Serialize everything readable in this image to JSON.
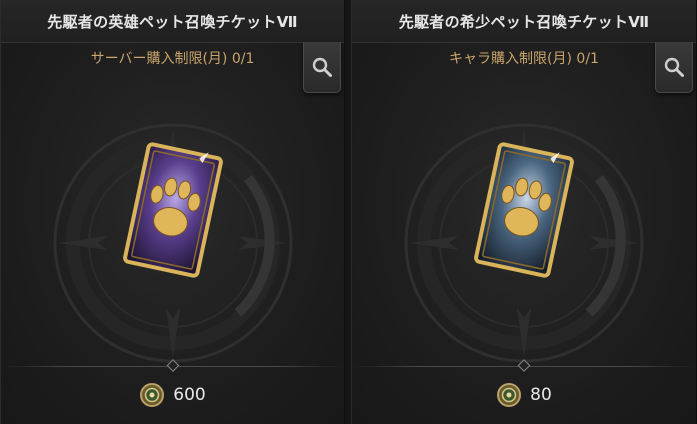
{
  "shop": {
    "items": [
      {
        "title": "先駆者の英雄ペット召喚チケットⅦ",
        "limit": "サーバー購入制限(月) 0/1",
        "ticket_gem_color": "#5a3f8e",
        "price": "600",
        "currency_icon": "medal-coin-icon",
        "inspect_icon": "magnifier-icon"
      },
      {
        "title": "先駆者の希少ペット召喚チケットⅦ",
        "limit": "キャラ購入制限(月) 0/1",
        "ticket_gem_color": "#4a6680",
        "price": "80",
        "currency_icon": "medal-coin-icon",
        "inspect_icon": "magnifier-icon"
      }
    ]
  }
}
